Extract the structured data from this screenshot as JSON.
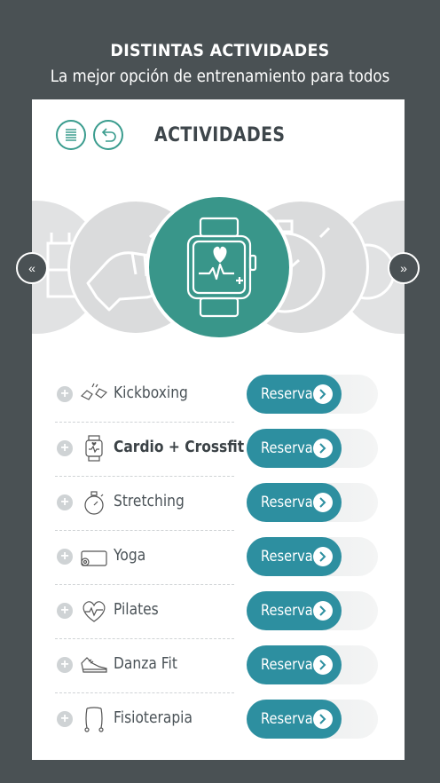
{
  "header": {
    "title": "DISTINTAS ACTIVIDADES",
    "subtitle": "La mejor opción de entrenamiento para todos"
  },
  "card": {
    "title": "ACTIVIDADES",
    "menu_icon": "menu-icon",
    "back_icon": "back-icon"
  },
  "carousel": {
    "prev_icon": "double-chevron-left-icon",
    "next_icon": "double-chevron-right-icon",
    "selected_icon": "smartwatch-heart-icon"
  },
  "activities": [
    {
      "name": "Kickboxing",
      "icon": "fist-bump-icon",
      "button": "Reservar",
      "selected": false
    },
    {
      "name": "Cardio + Crossfit",
      "icon": "smartwatch-icon",
      "button": "Reservar",
      "selected": true
    },
    {
      "name": "Stretching",
      "icon": "stopwatch-icon",
      "button": "Reservar",
      "selected": false
    },
    {
      "name": "Yoga",
      "icon": "yoga-mat-icon",
      "button": "Reservar",
      "selected": false
    },
    {
      "name": "Pilates",
      "icon": "heart-pulse-icon",
      "button": "Reservar",
      "selected": false
    },
    {
      "name": "Danza Fit",
      "icon": "sneaker-icon",
      "button": "Reservar",
      "selected": false
    },
    {
      "name": "Fisioterapia",
      "icon": "resistance-band-icon",
      "button": "Reservar",
      "selected": false
    }
  ],
  "colors": {
    "background": "#4a5154",
    "accent_teal": "#39968a",
    "button_blue": "#2d8fa0",
    "text_dark": "#3e464b"
  }
}
